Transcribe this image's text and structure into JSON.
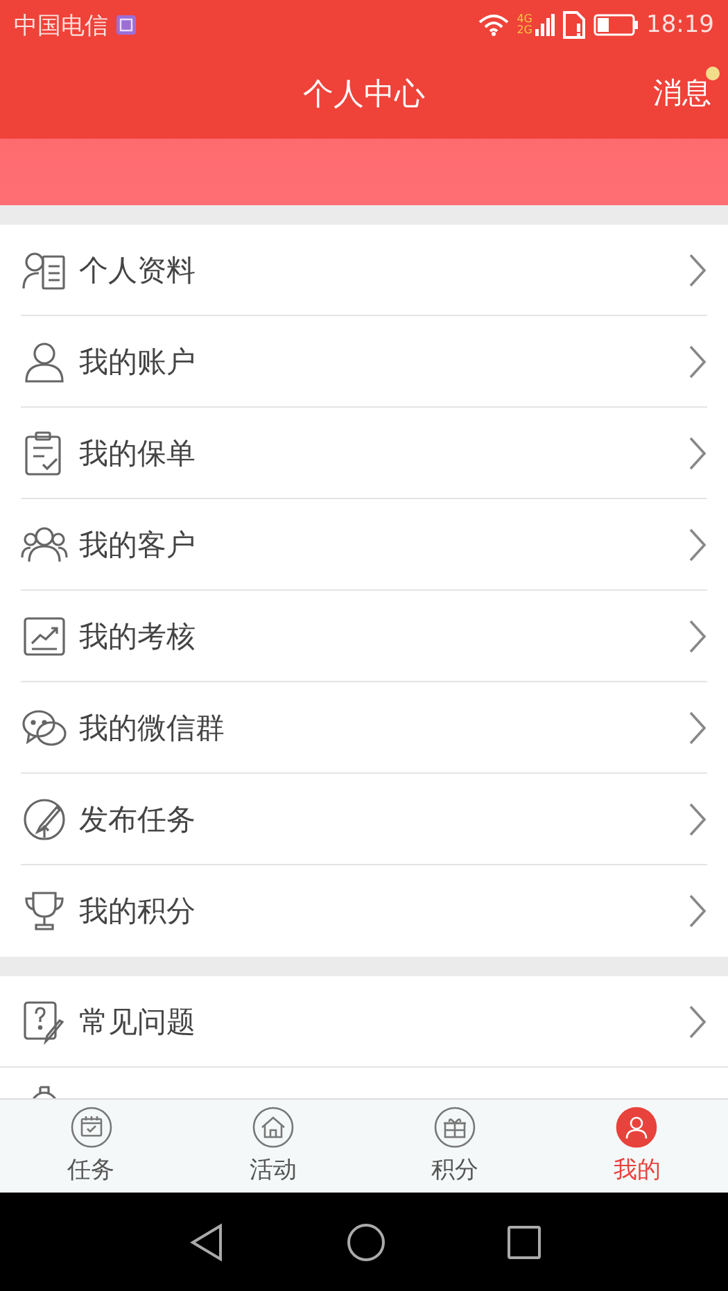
{
  "status_bar": {
    "carrier": "中国电信",
    "network_small": [
      "4G",
      "2G"
    ],
    "time": "18:19"
  },
  "header": {
    "title": "个人中心",
    "messages": {
      "label": "消息",
      "unread": true
    }
  },
  "menu_groups": [
    {
      "items": [
        {
          "label": "个人资料"
        },
        {
          "label": "我的账户"
        },
        {
          "label": "我的保单"
        },
        {
          "label": "我的客户"
        },
        {
          "label": "我的考核"
        },
        {
          "label": "我的微信群"
        },
        {
          "label": "发布任务"
        },
        {
          "label": "我的积分"
        }
      ]
    },
    {
      "items": [
        {
          "label": "常见问题"
        }
      ]
    }
  ],
  "tab_bar": [
    {
      "label": "任务",
      "selected": false
    },
    {
      "label": "活动",
      "selected": false
    },
    {
      "label": "积分",
      "selected": false
    },
    {
      "label": "我的",
      "selected": true
    }
  ]
}
